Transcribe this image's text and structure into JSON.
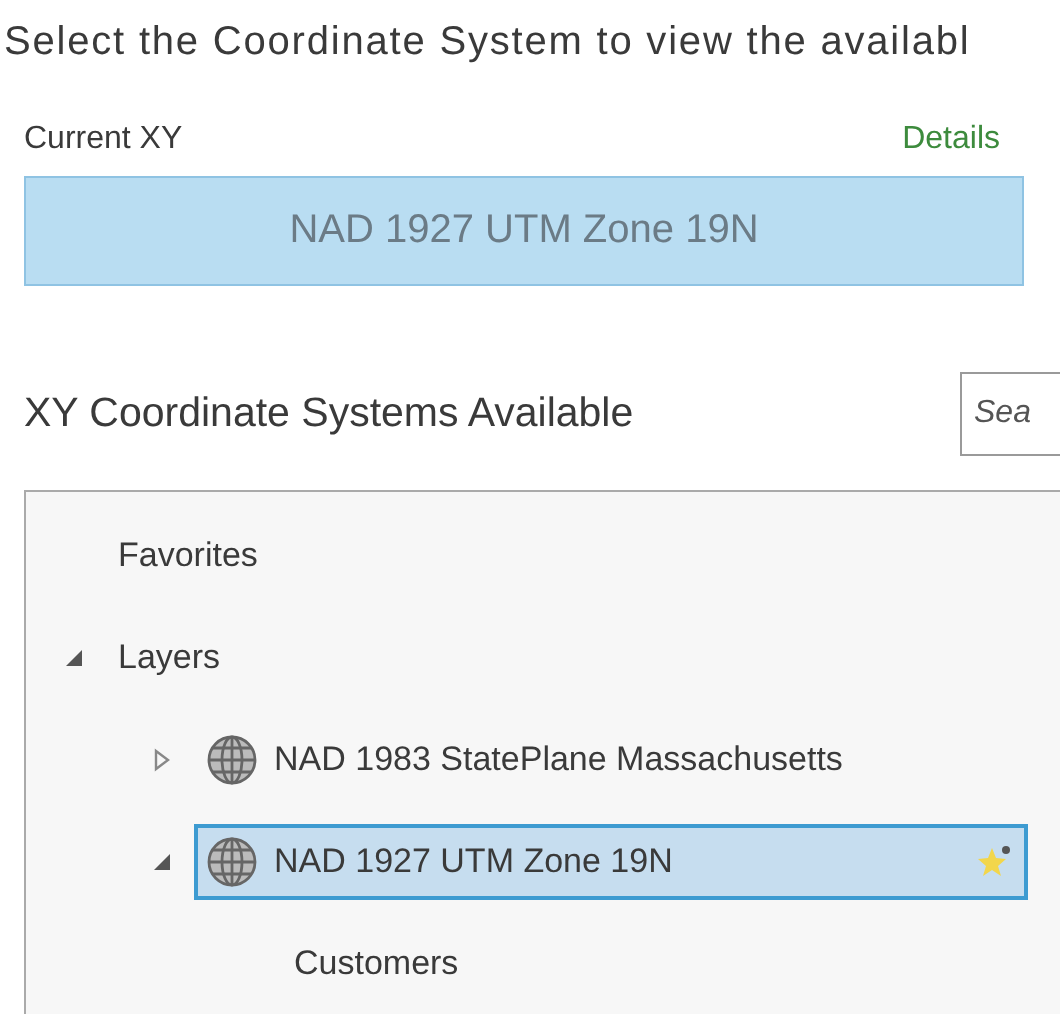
{
  "instruction": "Select the Coordinate System to view the availabl",
  "current": {
    "label": "Current XY",
    "link": "Details",
    "value": "NAD 1927 UTM Zone 19N"
  },
  "available": {
    "title": "XY Coordinate Systems Available",
    "search": {
      "placeholder": "Sea"
    }
  },
  "tree": [
    {
      "label": "Favorites",
      "selected": false
    },
    {
      "label": "Layers",
      "expanded": true,
      "selected": false,
      "children": [
        {
          "label": "NAD 1983 StatePlane Massachusetts",
          "kind": "coordinate-system",
          "expanded": false,
          "selected": false
        },
        {
          "label": "NAD 1927 UTM Zone 19N",
          "kind": "coordinate-system",
          "expanded": true,
          "selected": true,
          "favorite": true,
          "children": [
            {
              "label": "Customers",
              "selected": false
            }
          ]
        }
      ]
    }
  ]
}
